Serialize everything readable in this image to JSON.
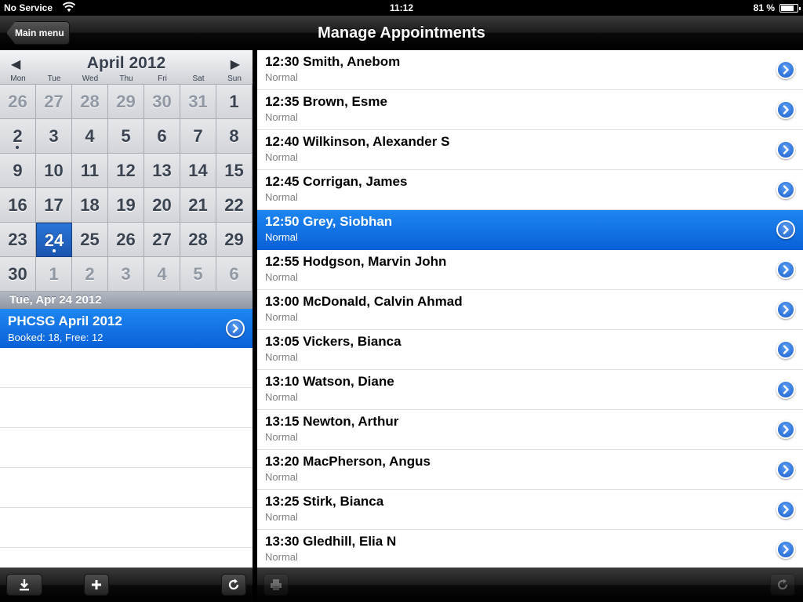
{
  "status": {
    "carrier": "No Service",
    "time": "11:12",
    "battery": "81 %",
    "battery_level": 0.81
  },
  "nav": {
    "title": "Manage Appointments",
    "back_label": "Main menu"
  },
  "calendar": {
    "month_label": "April 2012",
    "weekdays": [
      "Mon",
      "Tue",
      "Wed",
      "Thu",
      "Fri",
      "Sat",
      "Sun"
    ],
    "days": [
      {
        "d": "26",
        "other": true
      },
      {
        "d": "27",
        "other": true
      },
      {
        "d": "28",
        "other": true
      },
      {
        "d": "29",
        "other": true
      },
      {
        "d": "30",
        "other": true
      },
      {
        "d": "31",
        "other": true
      },
      {
        "d": "1"
      },
      {
        "d": "2",
        "dot": true
      },
      {
        "d": "3"
      },
      {
        "d": "4"
      },
      {
        "d": "5"
      },
      {
        "d": "6"
      },
      {
        "d": "7"
      },
      {
        "d": "8"
      },
      {
        "d": "9"
      },
      {
        "d": "10"
      },
      {
        "d": "11"
      },
      {
        "d": "12"
      },
      {
        "d": "13"
      },
      {
        "d": "14"
      },
      {
        "d": "15"
      },
      {
        "d": "16"
      },
      {
        "d": "17"
      },
      {
        "d": "18"
      },
      {
        "d": "19"
      },
      {
        "d": "20"
      },
      {
        "d": "21"
      },
      {
        "d": "22"
      },
      {
        "d": "23"
      },
      {
        "d": "24",
        "selected": true,
        "dot": true
      },
      {
        "d": "25"
      },
      {
        "d": "26"
      },
      {
        "d": "27"
      },
      {
        "d": "28"
      },
      {
        "d": "29"
      },
      {
        "d": "30"
      },
      {
        "d": "1",
        "other": true
      },
      {
        "d": "2",
        "other": true
      },
      {
        "d": "3",
        "other": true
      },
      {
        "d": "4",
        "other": true
      },
      {
        "d": "5",
        "other": true
      },
      {
        "d": "6",
        "other": true
      }
    ]
  },
  "selected_date": "Tue, Apr 24 2012",
  "session": {
    "title": "PHCSG April 2012",
    "subtitle": "Booked: 18, Free: 12"
  },
  "appointments": [
    {
      "title": "12:30 Smith, Anebom",
      "type": "Normal"
    },
    {
      "title": "12:35 Brown, Esme",
      "type": "Normal"
    },
    {
      "title": "12:40 Wilkinson, Alexander S",
      "type": "Normal"
    },
    {
      "title": "12:45 Corrigan, James",
      "type": "Normal"
    },
    {
      "title": "12:50 Grey, Siobhan",
      "type": "Normal",
      "selected": true
    },
    {
      "title": "12:55 Hodgson, Marvin John",
      "type": "Normal"
    },
    {
      "title": "13:00 McDonald, Calvin Ahmad",
      "type": "Normal"
    },
    {
      "title": "13:05 Vickers, Bianca",
      "type": "Normal"
    },
    {
      "title": "13:10 Watson, Diane",
      "type": "Normal"
    },
    {
      "title": "13:15 Newton, Arthur",
      "type": "Normal"
    },
    {
      "title": "13:20 MacPherson, Angus",
      "type": "Normal"
    },
    {
      "title": "13:25 Stirk, Bianca",
      "type": "Normal"
    },
    {
      "title": "13:30 Gledhill, Elia N",
      "type": "Normal"
    }
  ],
  "toolbar_left": [
    "download-icon",
    "add-icon",
    "refresh-icon"
  ],
  "toolbar_right": [
    "print-icon",
    "refresh-icon"
  ],
  "colors": {
    "selection_blue": "#0a61d8",
    "bar_black": "#000000"
  }
}
